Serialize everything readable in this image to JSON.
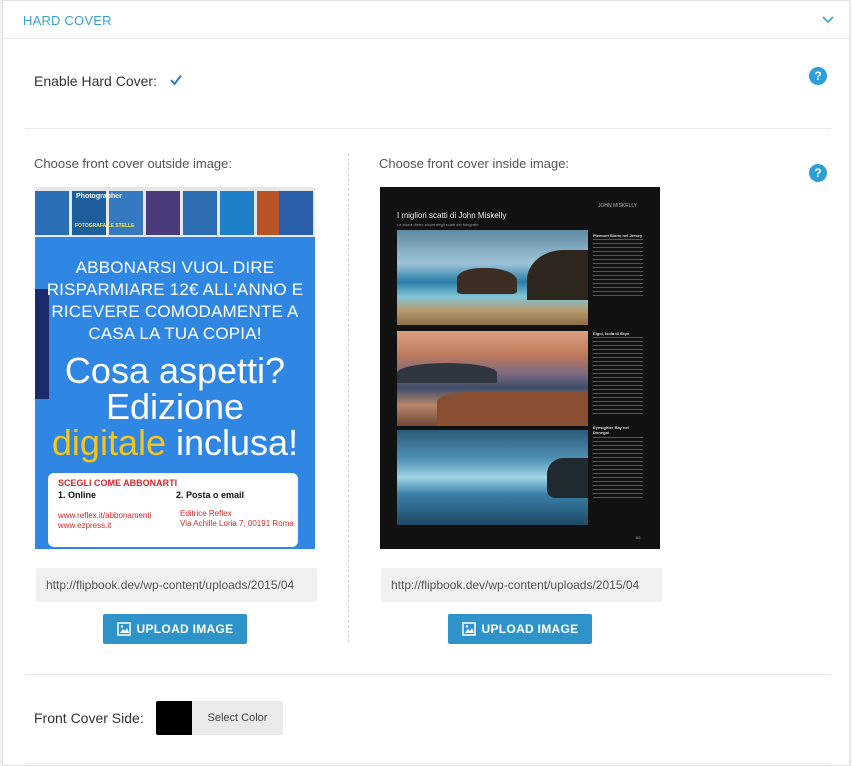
{
  "header": {
    "title": "HARD COVER"
  },
  "enable": {
    "label": "Enable Hard Cover:",
    "checked": true
  },
  "outside": {
    "label": "Choose front cover outside image:",
    "url": "http://flipbook.dev/wp-content/uploads/2015/04",
    "button": "UPLOAD IMAGE",
    "ad": {
      "lines": [
        "ABBONARSI VUOL DIRE",
        "RISPARMIARE 12€ ALL'ANNO E",
        "RICEVERE COMODAMENTE A",
        "CASA LA TUA COPIA!"
      ],
      "big1": "Cosa aspetti?",
      "big2": "Edizione",
      "big3a": "digitale",
      "big3b": " inclusa!",
      "card_title": "SCEGLI COME ABBONARTI",
      "opt1": "1. Online",
      "opt2": "2. Posta o email",
      "link1": "www.reflex.it/abbonamenti",
      "link2": "www.ezpress.it",
      "addr1": "Editrice Reflex",
      "addr2": "Via Achille Loria 7, 00191 Roma",
      "mag_title": "Photographer",
      "mag_sub": "FOTOGRAFA LE STELLE"
    }
  },
  "inside": {
    "label": "Choose front cover inside image:",
    "url": "http://flipbook.dev/wp-content/uploads/2015/04",
    "button": "UPLOAD IMAGE",
    "page": {
      "title": "I migliori scatti di John Miskelly",
      "subtitle": "La storia dietro alcuni degli scatti del fotografo",
      "header_right": "JOHN MISKELLY",
      "cap1": "Plemont Storm nel Jersey",
      "cap2": "Elgol, Isola di Skye",
      "cap3": "Eyesighter Bay nel Donegal",
      "page_no": "65"
    }
  },
  "front_side": {
    "label": "Front Cover Side:",
    "button": "Select Color",
    "color": "#000000"
  },
  "colors": {
    "accent": "#2e9fd9",
    "button": "#2d93c8"
  }
}
